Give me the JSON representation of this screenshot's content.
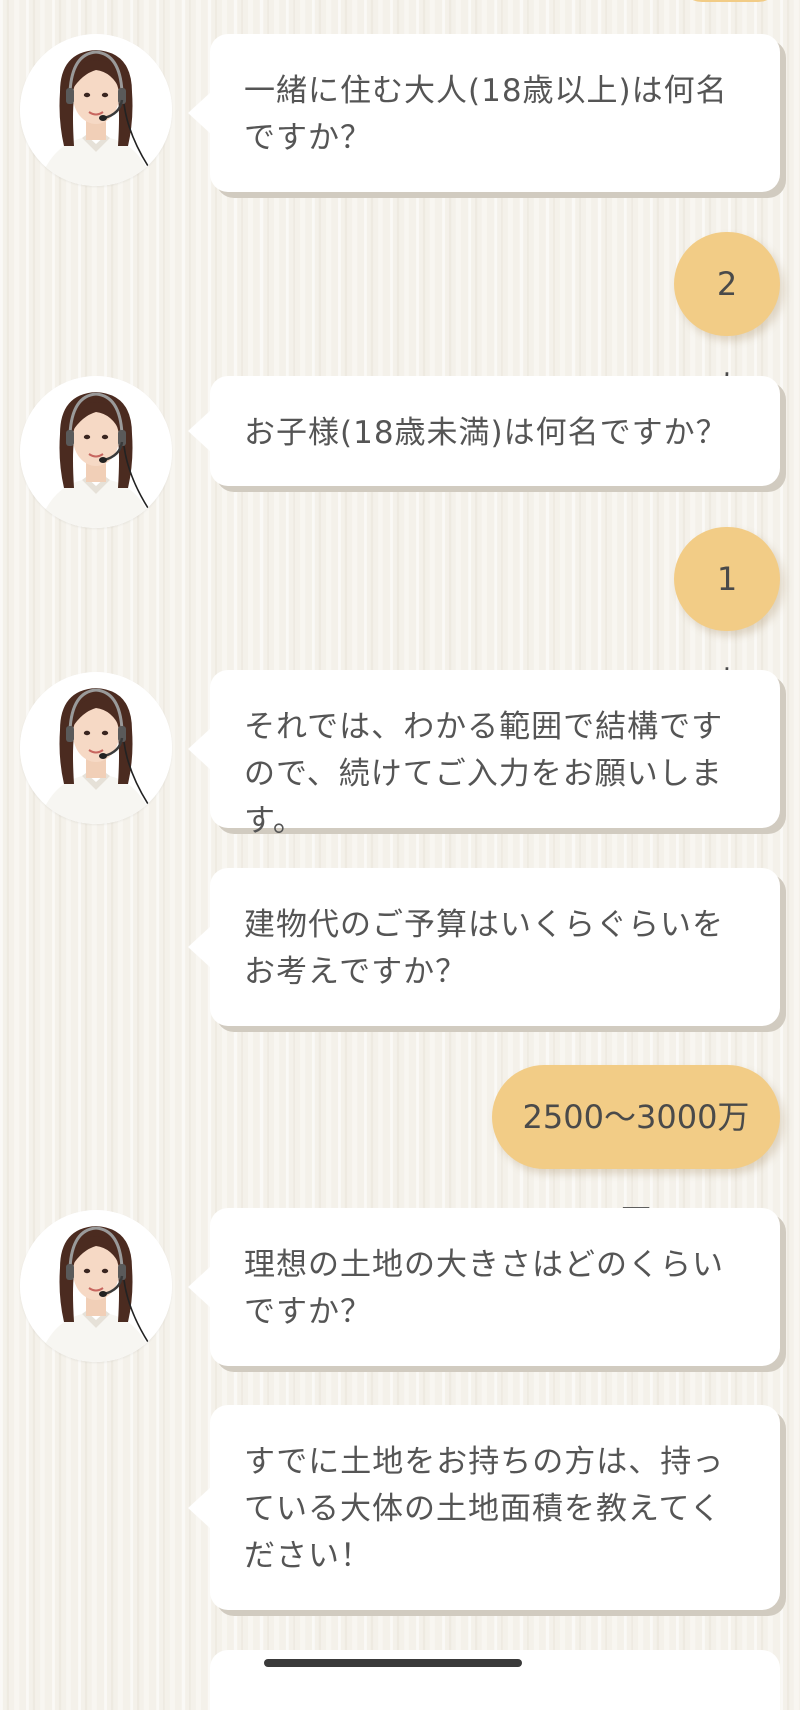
{
  "messages": {
    "q_adults": "一緒に住む大人(18歳以上)は何名ですか？",
    "a_adults": "2人",
    "q_children": "お子様(18歳未満)は何名ですか？",
    "a_children": "1人",
    "info_continue": "それでは、わかる範囲で結構ですので、続けてご入力をお願いします。",
    "q_budget": "建物代のご予算はいくらぐらいをお考えですか？",
    "a_budget": "2500〜3000万円",
    "q_land_size": "理想の土地の大きさはどのくらいですか？",
    "q_land_owned": "すでに土地をお持ちの方は、持っている大体の土地面積を教えてください！"
  },
  "colors": {
    "answer_bubble": "#f2cc86",
    "bot_bubble": "#ffffff",
    "text": "#555555",
    "background": "#f4f1ea"
  },
  "icons": {
    "operator_avatar": "operator-avatar-icon"
  }
}
